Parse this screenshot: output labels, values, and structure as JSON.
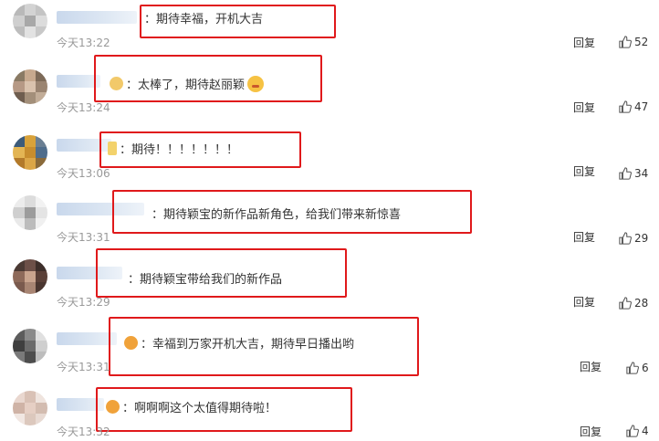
{
  "comments": [
    {
      "text": "：期待幸福，开机大吉",
      "time": "今天13:22",
      "reply": "回复",
      "likes": "52"
    },
    {
      "text": "：太棒了，期待赵丽颖",
      "time": "今天13:24",
      "reply": "回复",
      "likes": "47"
    },
    {
      "text": "：期待！！！！！！！",
      "time": "今天13:06",
      "reply": "回复",
      "likes": "34"
    },
    {
      "text": "：期待颖宝的新作品新角色，给我们带来新惊喜",
      "time": "今天13:31",
      "reply": "回复",
      "likes": "29"
    },
    {
      "text": "：期待颖宝带给我们的新作品",
      "time": "今天13:29",
      "reply": "回复",
      "likes": "28"
    },
    {
      "text": "：幸福到万家开机大吉，期待早日播出哟",
      "time": "今天13:31",
      "reply": "回复",
      "likes": "6"
    },
    {
      "text": "：啊啊啊这个太值得期待啦！",
      "time": "今天13:32",
      "reply": "回复",
      "likes": "4"
    }
  ],
  "icons": {
    "like": "thumbs-up-icon",
    "avatar": "blurred-avatar",
    "emoji": "emoji-icon"
  },
  "colors": {
    "highlight_box": "#e0191b",
    "time": "#999999",
    "username_blur": "#c9d8ec"
  }
}
